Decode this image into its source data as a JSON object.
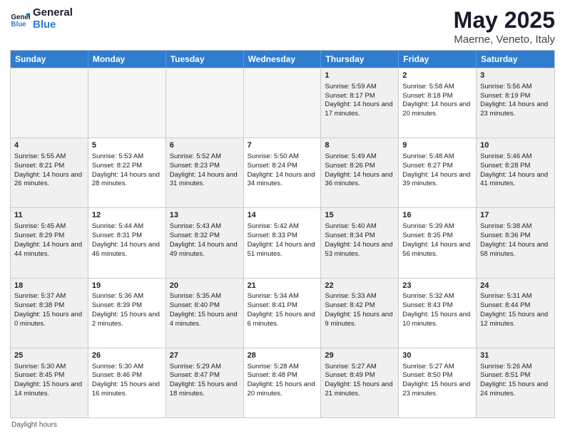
{
  "logo": {
    "text1": "General",
    "text2": "Blue"
  },
  "title": "May 2025",
  "subtitle": "Maerne, Veneto, Italy",
  "days_of_week": [
    "Sunday",
    "Monday",
    "Tuesday",
    "Wednesday",
    "Thursday",
    "Friday",
    "Saturday"
  ],
  "footer": "Daylight hours",
  "weeks": [
    [
      {
        "day": "",
        "empty": true
      },
      {
        "day": "",
        "empty": true
      },
      {
        "day": "",
        "empty": true
      },
      {
        "day": "",
        "empty": true
      },
      {
        "day": "1",
        "sunrise": "Sunrise: 5:59 AM",
        "sunset": "Sunset: 8:17 PM",
        "daylight": "Daylight: 14 hours and 17 minutes."
      },
      {
        "day": "2",
        "sunrise": "Sunrise: 5:58 AM",
        "sunset": "Sunset: 8:18 PM",
        "daylight": "Daylight: 14 hours and 20 minutes."
      },
      {
        "day": "3",
        "sunrise": "Sunrise: 5:56 AM",
        "sunset": "Sunset: 8:19 PM",
        "daylight": "Daylight: 14 hours and 23 minutes."
      }
    ],
    [
      {
        "day": "4",
        "sunrise": "Sunrise: 5:55 AM",
        "sunset": "Sunset: 8:21 PM",
        "daylight": "Daylight: 14 hours and 26 minutes."
      },
      {
        "day": "5",
        "sunrise": "Sunrise: 5:53 AM",
        "sunset": "Sunset: 8:22 PM",
        "daylight": "Daylight: 14 hours and 28 minutes."
      },
      {
        "day": "6",
        "sunrise": "Sunrise: 5:52 AM",
        "sunset": "Sunset: 8:23 PM",
        "daylight": "Daylight: 14 hours and 31 minutes."
      },
      {
        "day": "7",
        "sunrise": "Sunrise: 5:50 AM",
        "sunset": "Sunset: 8:24 PM",
        "daylight": "Daylight: 14 hours and 34 minutes."
      },
      {
        "day": "8",
        "sunrise": "Sunrise: 5:49 AM",
        "sunset": "Sunset: 8:26 PM",
        "daylight": "Daylight: 14 hours and 36 minutes."
      },
      {
        "day": "9",
        "sunrise": "Sunrise: 5:48 AM",
        "sunset": "Sunset: 8:27 PM",
        "daylight": "Daylight: 14 hours and 39 minutes."
      },
      {
        "day": "10",
        "sunrise": "Sunrise: 5:46 AM",
        "sunset": "Sunset: 8:28 PM",
        "daylight": "Daylight: 14 hours and 41 minutes."
      }
    ],
    [
      {
        "day": "11",
        "sunrise": "Sunrise: 5:45 AM",
        "sunset": "Sunset: 8:29 PM",
        "daylight": "Daylight: 14 hours and 44 minutes."
      },
      {
        "day": "12",
        "sunrise": "Sunrise: 5:44 AM",
        "sunset": "Sunset: 8:31 PM",
        "daylight": "Daylight: 14 hours and 46 minutes."
      },
      {
        "day": "13",
        "sunrise": "Sunrise: 5:43 AM",
        "sunset": "Sunset: 8:32 PM",
        "daylight": "Daylight: 14 hours and 49 minutes."
      },
      {
        "day": "14",
        "sunrise": "Sunrise: 5:42 AM",
        "sunset": "Sunset: 8:33 PM",
        "daylight": "Daylight: 14 hours and 51 minutes."
      },
      {
        "day": "15",
        "sunrise": "Sunrise: 5:40 AM",
        "sunset": "Sunset: 8:34 PM",
        "daylight": "Daylight: 14 hours and 53 minutes."
      },
      {
        "day": "16",
        "sunrise": "Sunrise: 5:39 AM",
        "sunset": "Sunset: 8:35 PM",
        "daylight": "Daylight: 14 hours and 56 minutes."
      },
      {
        "day": "17",
        "sunrise": "Sunrise: 5:38 AM",
        "sunset": "Sunset: 8:36 PM",
        "daylight": "Daylight: 14 hours and 58 minutes."
      }
    ],
    [
      {
        "day": "18",
        "sunrise": "Sunrise: 5:37 AM",
        "sunset": "Sunset: 8:38 PM",
        "daylight": "Daylight: 15 hours and 0 minutes."
      },
      {
        "day": "19",
        "sunrise": "Sunrise: 5:36 AM",
        "sunset": "Sunset: 8:39 PM",
        "daylight": "Daylight: 15 hours and 2 minutes."
      },
      {
        "day": "20",
        "sunrise": "Sunrise: 5:35 AM",
        "sunset": "Sunset: 8:40 PM",
        "daylight": "Daylight: 15 hours and 4 minutes."
      },
      {
        "day": "21",
        "sunrise": "Sunrise: 5:34 AM",
        "sunset": "Sunset: 8:41 PM",
        "daylight": "Daylight: 15 hours and 6 minutes."
      },
      {
        "day": "22",
        "sunrise": "Sunrise: 5:33 AM",
        "sunset": "Sunset: 8:42 PM",
        "daylight": "Daylight: 15 hours and 9 minutes."
      },
      {
        "day": "23",
        "sunrise": "Sunrise: 5:32 AM",
        "sunset": "Sunset: 8:43 PM",
        "daylight": "Daylight: 15 hours and 10 minutes."
      },
      {
        "day": "24",
        "sunrise": "Sunrise: 5:31 AM",
        "sunset": "Sunset: 8:44 PM",
        "daylight": "Daylight: 15 hours and 12 minutes."
      }
    ],
    [
      {
        "day": "25",
        "sunrise": "Sunrise: 5:30 AM",
        "sunset": "Sunset: 8:45 PM",
        "daylight": "Daylight: 15 hours and 14 minutes."
      },
      {
        "day": "26",
        "sunrise": "Sunrise: 5:30 AM",
        "sunset": "Sunset: 8:46 PM",
        "daylight": "Daylight: 15 hours and 16 minutes."
      },
      {
        "day": "27",
        "sunrise": "Sunrise: 5:29 AM",
        "sunset": "Sunset: 8:47 PM",
        "daylight": "Daylight: 15 hours and 18 minutes."
      },
      {
        "day": "28",
        "sunrise": "Sunrise: 5:28 AM",
        "sunset": "Sunset: 8:48 PM",
        "daylight": "Daylight: 15 hours and 20 minutes."
      },
      {
        "day": "29",
        "sunrise": "Sunrise: 5:27 AM",
        "sunset": "Sunset: 8:49 PM",
        "daylight": "Daylight: 15 hours and 21 minutes."
      },
      {
        "day": "30",
        "sunrise": "Sunrise: 5:27 AM",
        "sunset": "Sunset: 8:50 PM",
        "daylight": "Daylight: 15 hours and 23 minutes."
      },
      {
        "day": "31",
        "sunrise": "Sunrise: 5:26 AM",
        "sunset": "Sunset: 8:51 PM",
        "daylight": "Daylight: 15 hours and 24 minutes."
      }
    ]
  ]
}
